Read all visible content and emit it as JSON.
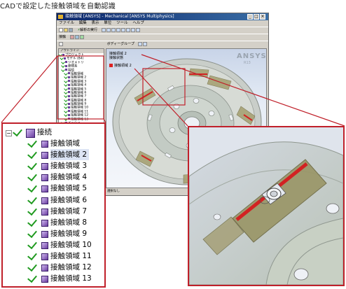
{
  "caption": "CADで設定した接触領域を自動認識",
  "window": {
    "title": "接触領域 [ANSYS] - Mechanical [ANSYS Multiphysics]",
    "menu": [
      "ファイル",
      "編集",
      "表示",
      "単位",
      "ツール",
      "ヘルプ"
    ],
    "toolbar_row1": "解析の実行",
    "toolbar_row2": "接触",
    "toolbar_row3": "ボディーグループ",
    "outline_header": "アウトライン",
    "outline_rows": [
      "プロジェクト",
      "モデル (B4)",
      "ジオメトリ",
      "座標系",
      "接続",
      "接触領域",
      "接触領域 2",
      "接触領域 3",
      "接触領域 4",
      "接触領域 5",
      "接触領域 6",
      "接触領域 7",
      "接触領域 8",
      "接触領域 9",
      "接触領域 10",
      "接触領域 11",
      "接触領域 12",
      "接触領域 13",
      "メッシュ",
      "静的構造 (B5)",
      "解析設定",
      "結果 (B6)"
    ],
    "viewport_line1": "接触領域 2",
    "viewport_line2": "接触状態",
    "legend_label": "接触領域 2",
    "logo": "ANSYS",
    "logo_sub": "R13",
    "status": "選択なし"
  },
  "tree": {
    "parent": "接続",
    "items": [
      "接触領域",
      "接触領域 2",
      "接触領域 3",
      "接触領域 4",
      "接触領域 5",
      "接触領域 6",
      "接触領域 7",
      "接触領域 8",
      "接触領域 9",
      "接触領域 10",
      "接触領域 11",
      "接触領域 12",
      "接触領域 13"
    ],
    "selected_index": 1,
    "last_partial": "メッシュ"
  },
  "colors": {
    "callout": "#c0202a",
    "contact": "#d22222",
    "check": "#1f9a1f"
  }
}
